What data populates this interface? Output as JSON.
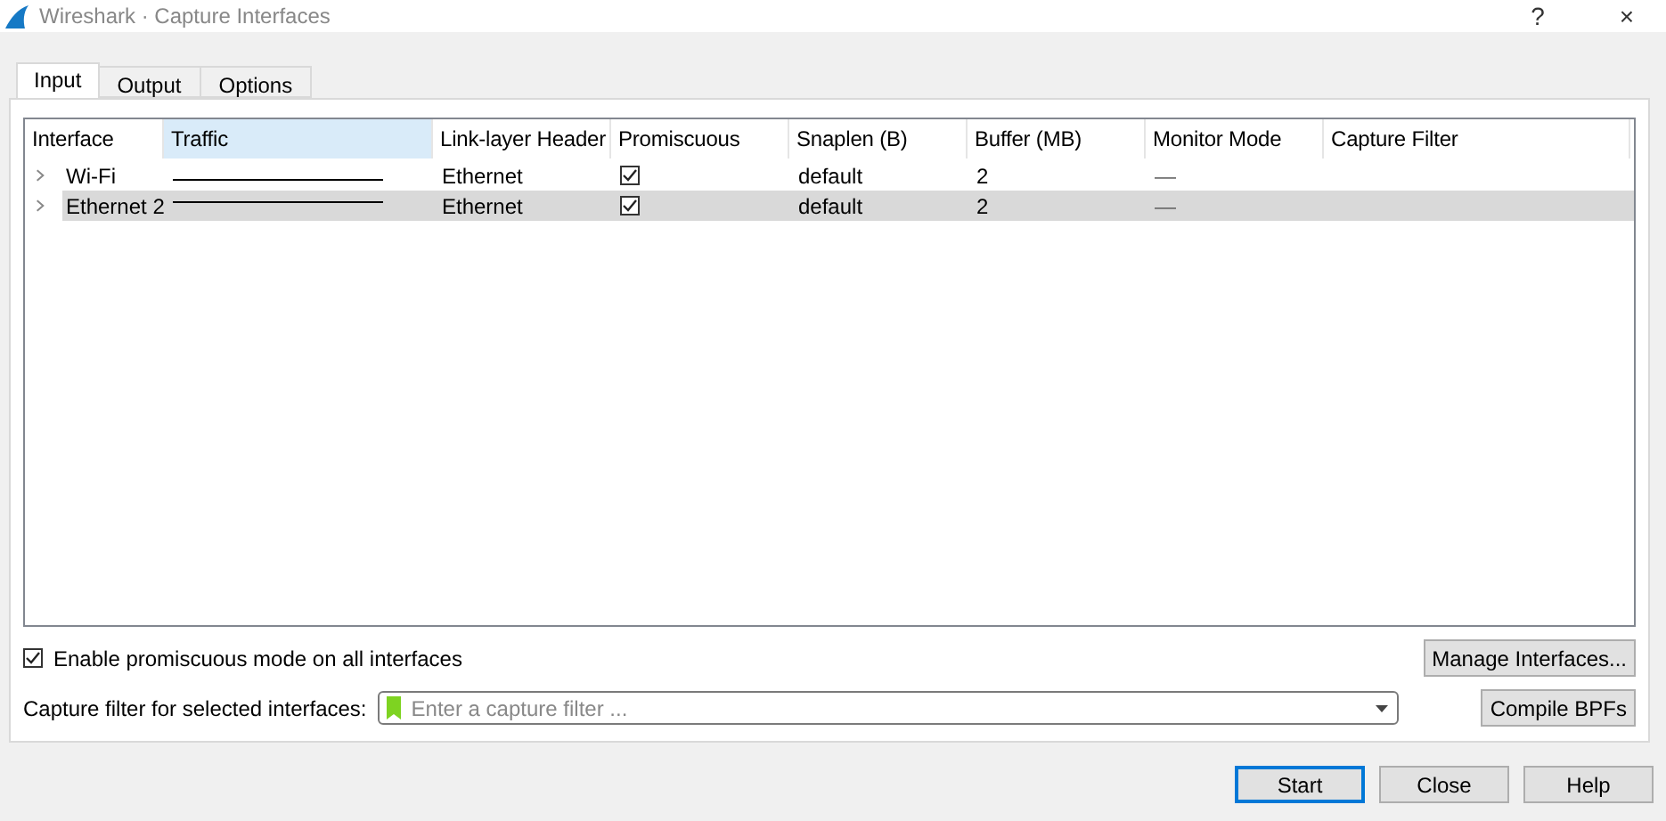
{
  "window": {
    "title": "Wireshark · Capture Interfaces",
    "help": "?",
    "close": "×"
  },
  "tabs": [
    {
      "label": "Input",
      "selected": true
    },
    {
      "label": "Output",
      "selected": false
    },
    {
      "label": "Options",
      "selected": false
    }
  ],
  "table": {
    "columns": [
      {
        "label": "Interface",
        "selected": false
      },
      {
        "label": "Traffic",
        "selected": true
      },
      {
        "label": "Link-layer Header",
        "selected": false
      },
      {
        "label": "Promiscuous",
        "selected": false
      },
      {
        "label": "Snaplen (B)",
        "selected": false
      },
      {
        "label": "Buffer (MB)",
        "selected": false
      },
      {
        "label": "Monitor Mode",
        "selected": false
      },
      {
        "label": "Capture Filter",
        "selected": false
      }
    ],
    "rows": [
      {
        "interface": "Wi-Fi",
        "expanded": false,
        "link_layer": "Ethernet",
        "promiscuous": true,
        "snaplen": "default",
        "buffer": "2",
        "monitor_mode": "—",
        "selected": false
      },
      {
        "interface": "Ethernet 2",
        "expanded": false,
        "link_layer": "Ethernet",
        "promiscuous": true,
        "snaplen": "default",
        "buffer": "2",
        "monitor_mode": "—",
        "selected": true
      }
    ]
  },
  "promiscuous_all": {
    "label": "Enable promiscuous mode on all interfaces",
    "checked": true
  },
  "manage_button": "Manage Interfaces...",
  "filter": {
    "label": "Capture filter for selected interfaces:",
    "placeholder": "Enter a capture filter ..."
  },
  "compile_button": "Compile BPFs",
  "buttons": [
    {
      "label": "Start",
      "kind": "default"
    },
    {
      "label": "Close",
      "kind": "normal"
    },
    {
      "label": "Help",
      "kind": "normal"
    }
  ]
}
